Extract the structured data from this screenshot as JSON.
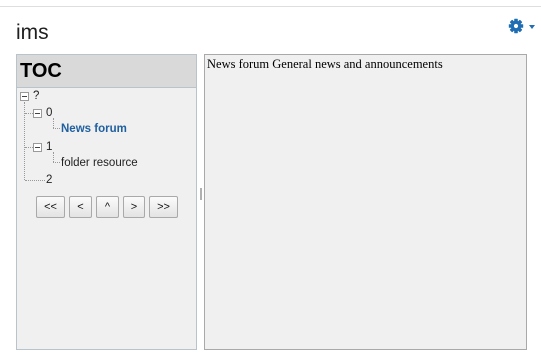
{
  "page": {
    "title": "ims"
  },
  "toolbar": {
    "settings_icon": "gear-icon",
    "settings_color": "#1f6db3"
  },
  "toc": {
    "header": "TOC",
    "root_label": "?",
    "nodes": [
      {
        "label": "0"
      },
      {
        "label": "News forum"
      },
      {
        "label": "1"
      },
      {
        "label": "folder resource"
      },
      {
        "label": "2"
      }
    ]
  },
  "navigation": {
    "first": "<<",
    "prev": "<",
    "up": "^",
    "next": ">",
    "last": ">>"
  },
  "content": {
    "text": "News forum General news and announcements"
  },
  "colors": {
    "link": "#2060a0",
    "panel_bg": "#f0f0f0",
    "toc_header_bg": "#d9d9d9"
  }
}
